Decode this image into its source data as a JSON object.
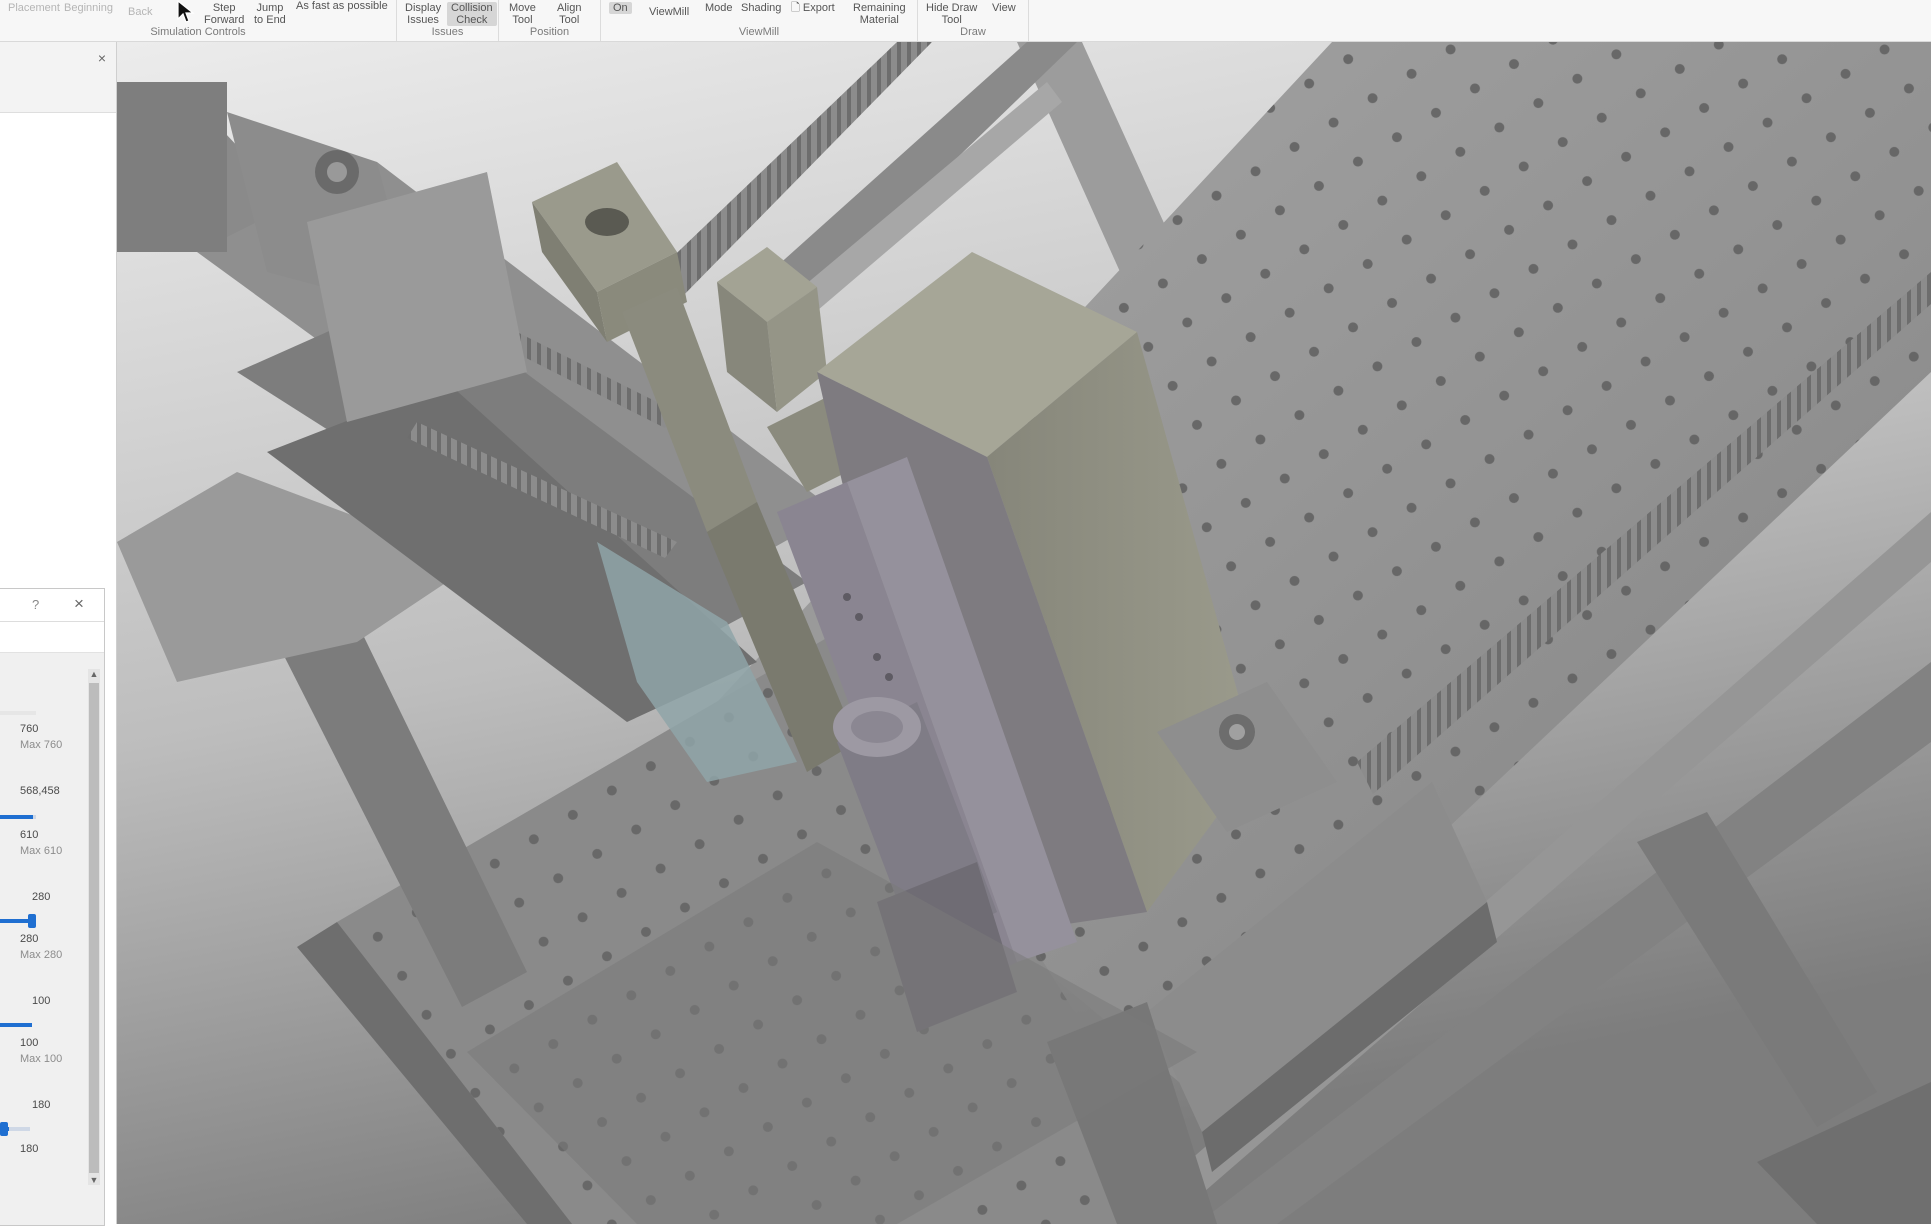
{
  "ribbon": {
    "groups": [
      {
        "label": "Simulation Controls"
      },
      {
        "label": "Issues"
      },
      {
        "label": "Position"
      },
      {
        "label": "ViewMill"
      },
      {
        "label": "Draw"
      }
    ],
    "buttons": {
      "b1": "Placement",
      "b2": "Beginning",
      "b3": "Back",
      "b4": "Step\nForward",
      "b5": "Jump\nto End",
      "b6": "As fast as possible",
      "b7": "Display\nIssues",
      "b8": "Collision\nCheck",
      "b9": "Move\nTool",
      "b10": "Align\nTool",
      "b11": "On",
      "b12": "ViewMill",
      "b13": "Mode",
      "b14": "Shading",
      "b15": "Export",
      "b16": "Remaining\nMaterial",
      "b17": "Hide Draw\nTool",
      "b18": "View"
    }
  },
  "side_panel": {
    "close_glyph": "×"
  },
  "dialog": {
    "help_glyph": "?",
    "close_glyph": "×",
    "axes": [
      {
        "value": "760",
        "max": "Max 760",
        "level": 0
      },
      {
        "value": "568,458",
        "value2": "610",
        "max": "Max 610",
        "level": 0.93
      },
      {
        "value": "280",
        "value2": "280",
        "max": "Max 280",
        "level": 1.0
      },
      {
        "value": "100",
        "value2": "100",
        "max": "Max 100",
        "level": 1.0
      },
      {
        "value": "180",
        "value2": "180",
        "max": "",
        "level": 0.3
      }
    ]
  },
  "colors": {
    "accent": "#1f6fd1",
    "machine": "#7b7b7b",
    "table": "#8f8f8f",
    "spindle_head": "#8a8a7a"
  }
}
